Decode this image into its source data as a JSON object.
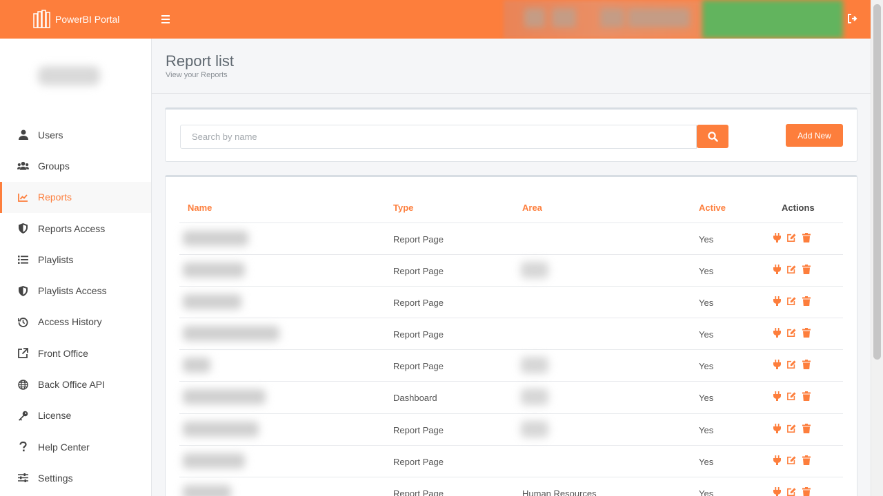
{
  "header": {
    "brand": "PowerBI Portal",
    "colors": {
      "accent": "#fd7e3c"
    }
  },
  "sidebar": {
    "items": [
      {
        "label": "Users",
        "icon": "user-icon",
        "active": false
      },
      {
        "label": "Groups",
        "icon": "users-icon",
        "active": false
      },
      {
        "label": "Reports",
        "icon": "chart-line-icon",
        "active": true
      },
      {
        "label": "Reports Access",
        "icon": "shield-icon",
        "active": false
      },
      {
        "label": "Playlists",
        "icon": "list-icon",
        "active": false
      },
      {
        "label": "Playlists Access",
        "icon": "shield-icon",
        "active": false
      },
      {
        "label": "Access History",
        "icon": "history-icon",
        "active": false
      },
      {
        "label": "Front Office",
        "icon": "external-link-icon",
        "active": false
      },
      {
        "label": "Back Office API",
        "icon": "globe-icon",
        "active": false
      },
      {
        "label": "License",
        "icon": "key-icon",
        "active": false
      },
      {
        "label": "Help Center",
        "icon": "question-icon",
        "active": false
      },
      {
        "label": "Settings",
        "icon": "sliders-icon",
        "active": false
      }
    ]
  },
  "page": {
    "title": "Report list",
    "subtitle": "View your Reports"
  },
  "search": {
    "placeholder": "Search by name",
    "add_label": "Add New"
  },
  "table": {
    "columns": [
      "Name",
      "Type",
      "Area",
      "Active",
      "Actions"
    ],
    "rows": [
      {
        "type": "Report Page",
        "area": "",
        "active": "Yes"
      },
      {
        "type": "Report Page",
        "area": "",
        "active": "Yes"
      },
      {
        "type": "Report Page",
        "area": "",
        "active": "Yes"
      },
      {
        "type": "Report Page",
        "area": "",
        "active": "Yes"
      },
      {
        "type": "Report Page",
        "area": "",
        "active": "Yes"
      },
      {
        "type": "Dashboard",
        "area": "",
        "active": "Yes"
      },
      {
        "type": "Report Page",
        "area": "",
        "active": "Yes"
      },
      {
        "type": "Report Page",
        "area": "",
        "active": "Yes"
      },
      {
        "type": "Report Page",
        "area": "Human Resources",
        "active": "Yes"
      }
    ]
  }
}
